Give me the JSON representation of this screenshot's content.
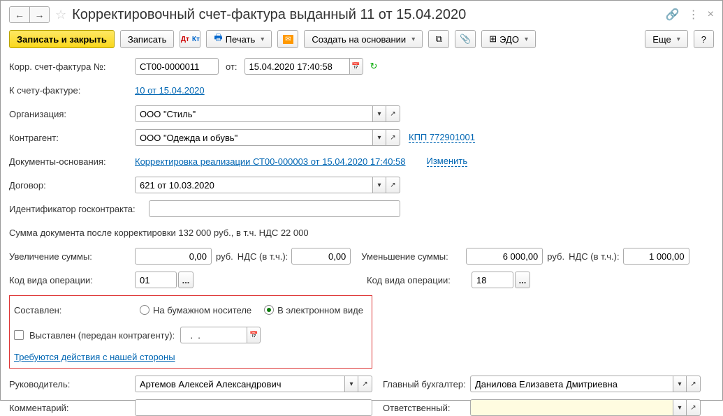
{
  "title": "Корректировочный счет-фактура выданный 11 от 15.04.2020",
  "toolbar": {
    "save_close": "Записать и закрыть",
    "save": "Записать",
    "print": "Печать",
    "create_based": "Создать на основании",
    "edo": "ЭДО",
    "more": "Еще",
    "help": "?"
  },
  "labels": {
    "corr_number": "Корр. счет-фактура №:",
    "from": "от:",
    "to_invoice": "К счету-фактуре:",
    "org": "Организация:",
    "counterparty": "Контрагент:",
    "basis_docs": "Документы-основания:",
    "contract": "Договор:",
    "gov_contract_id": "Идентификатор госконтракта:",
    "sum_after": "Сумма документа после корректировки 132 000 руб., в т.ч. НДС 22 000",
    "increase": "Увеличение суммы:",
    "decrease": "Уменьшение суммы:",
    "rub": "руб.",
    "vat_incl": "НДС (в т.ч.):",
    "op_code": "Код вида операции:",
    "composed": "Составлен:",
    "paper": "На бумажном носителе",
    "electronic": "В электронном виде",
    "issued": "Выставлен (передан контрагенту):",
    "action_required": "Требуются действия с нашей стороны",
    "manager": "Руководитель:",
    "chief_acc": "Главный бухгалтер:",
    "comment": "Комментарий:",
    "responsible": "Ответственный:",
    "change": "Изменить",
    "kpp": "КПП 772901001"
  },
  "values": {
    "number": "СТ00-0000011",
    "date": "15.04.2020 17:40:58",
    "to_invoice_link": "10 от 15.04.2020",
    "org": "ООО \"Стиль\"",
    "counterparty": "ООО \"Одежда и обувь\"",
    "basis_link": "Корректировка реализации СТ00-000003 от 15.04.2020 17:40:58",
    "contract": "621 от 10.03.2020",
    "gov_id": "",
    "increase_sum": "0,00",
    "increase_vat": "0,00",
    "decrease_sum": "6 000,00",
    "decrease_vat": "1 000,00",
    "op_code1": "01",
    "op_code2": "18",
    "issued_date": "  .  .    ",
    "manager": "Артемов Алексей Александрович",
    "chief_acc": "Данилова Елизавета Дмитриевна",
    "comment": "",
    "responsible": ""
  }
}
